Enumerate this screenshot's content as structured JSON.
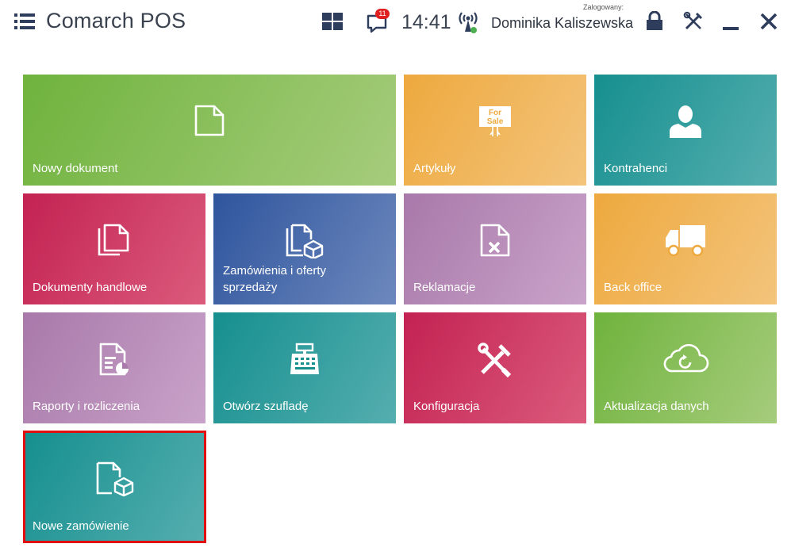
{
  "header": {
    "app_title": "Comarch POS",
    "notification_count": "11",
    "time": "14:41",
    "logged_label": "Zalogowany:",
    "user_name": "Dominika Kaliszewska",
    "icons": [
      "menu-icon",
      "tiles-icon",
      "chat-icon",
      "signal-icon",
      "lock-icon",
      "tools-icon",
      "minimize-icon",
      "close-icon"
    ]
  },
  "tiles": {
    "new_document": "Nowy dokument",
    "articles": "Artykuły",
    "contractors": "Kontrahenci",
    "trade_documents": "Dokumenty handlowe",
    "orders_offers": "Zamówienia i oferty sprzedaży",
    "complaints": "Reklamacje",
    "back_office": "Back office",
    "reports": "Raporty i rozliczenia",
    "open_drawer": "Otwórz szufladę",
    "configuration": "Konfiguracja",
    "data_update": "Aktualizacja danych",
    "new_order": "Nowe zamówienie"
  },
  "for_sale_sign": {
    "line1": "For",
    "line2": "Sale"
  },
  "selected_tile": "Nowe zamówienie",
  "colors": {
    "green": "#6fb33d",
    "orange": "#eea93e",
    "teal": "#168f8f",
    "red": "#c32252",
    "blue": "#2f559d",
    "purple": "#a879aa",
    "selection": "#e10f0f"
  }
}
